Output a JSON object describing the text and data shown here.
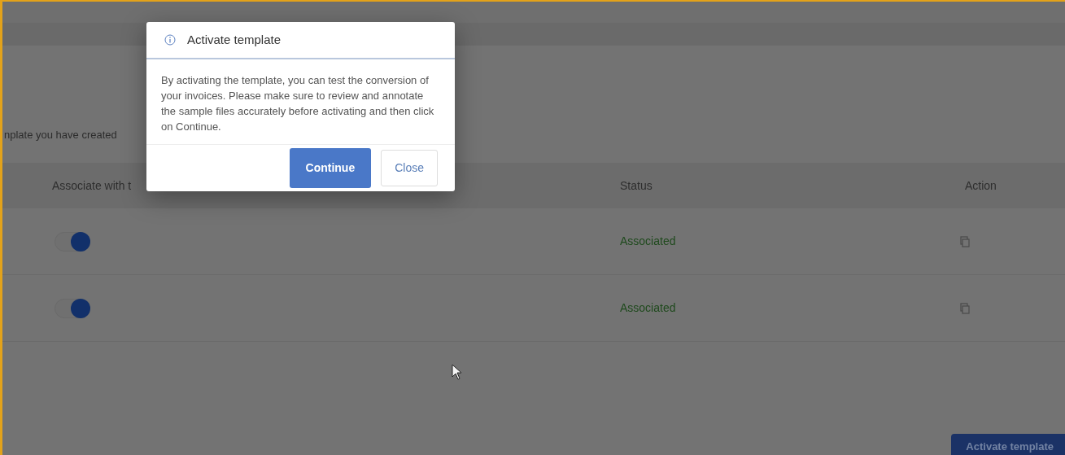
{
  "page": {
    "intro_text": "nplate you have created",
    "table": {
      "columns": [
        "Associate with t",
        "Status",
        "Action"
      ],
      "rows": [
        {
          "on": true,
          "status": "Associated"
        },
        {
          "on": true,
          "status": "Associated"
        }
      ]
    },
    "primary_button": "Activate template"
  },
  "dialog": {
    "title": "Activate template",
    "body": "By activating the template, you can test the conversion of your invoices. Please make sure to review and annotate the sample files accurately before activating and then click on Continue.",
    "buttons": [
      {
        "label": "Continue",
        "kind": "primary"
      },
      {
        "label": "Close",
        "kind": "secondary"
      }
    ]
  }
}
